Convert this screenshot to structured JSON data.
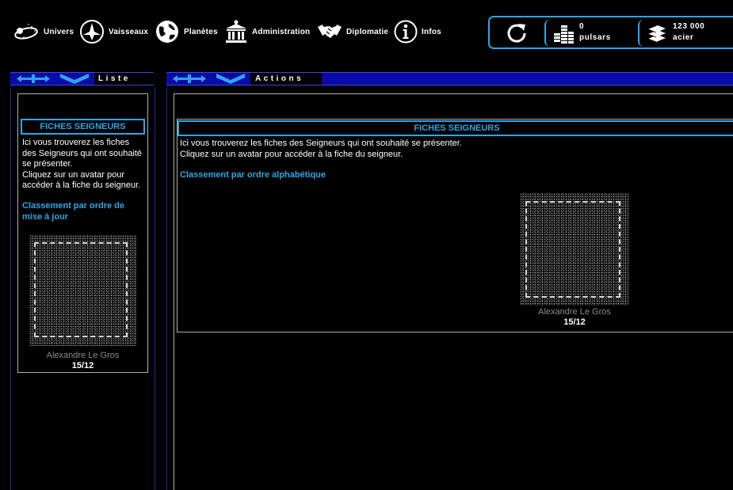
{
  "nav": [
    {
      "label": "Univers",
      "icon": "universe-icon"
    },
    {
      "label": "Vaisseaux",
      "icon": "ship-icon"
    },
    {
      "label": "Planètes",
      "icon": "planet-icon"
    },
    {
      "label": "Administration",
      "icon": "building-icon"
    },
    {
      "label": "Diplomatie",
      "icon": "handshake-icon"
    },
    {
      "label": "Infos",
      "icon": "info-icon"
    }
  ],
  "resources": [
    {
      "amount": "0",
      "name": "pulsars",
      "icon": "coins-icon"
    },
    {
      "amount": "123 000",
      "name": "acier",
      "icon": "steel-icon"
    }
  ],
  "colors": {
    "accent": "#2fa6e6",
    "header_bg": "#0a0aa8"
  },
  "left_panel": {
    "title": "Liste",
    "section_title": "FICHES SEIGNEURS",
    "description_1": "Ici vous trouverez les fiches des Seigneurs qui ont souhaité se présenter.",
    "description_2": "Cliquez sur un avatar pour accéder à la fiche du seigneur.",
    "sort_link": "Classement par ordre de mise à jour",
    "lord": {
      "name": "Alexandre Le Gros",
      "date": "15/12"
    }
  },
  "main_panel": {
    "title": "Actions",
    "section_title": "FICHES SEIGNEURS",
    "description_1": "Ici vous trouverez les fiches des Seigneurs qui ont souhaité se présenter.",
    "description_2": "Cliquez sur un avatar pour accéder à la fiche du seigneur.",
    "sort_link": "Classement par ordre alphabétique",
    "lord": {
      "name": "Alexandre Le Gros",
      "date": "15/12"
    }
  }
}
